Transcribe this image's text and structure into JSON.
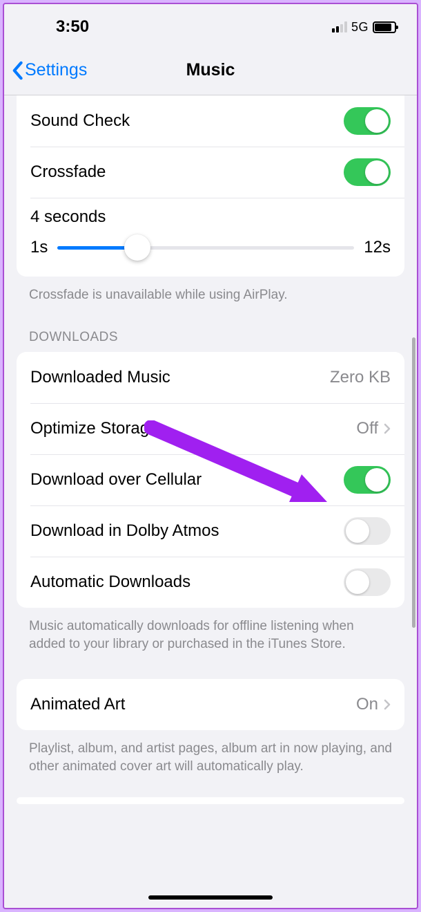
{
  "status": {
    "time": "3:50",
    "network": "5G",
    "signal_active_bars": 2,
    "battery_percent": 85
  },
  "nav": {
    "back_label": "Settings",
    "title": "Music"
  },
  "audio": {
    "sound_check": {
      "label": "Sound Check",
      "on": true
    },
    "crossfade": {
      "label": "Crossfade",
      "on": true
    },
    "slider": {
      "value_label": "4 seconds",
      "min_label": "1s",
      "max_label": "12s",
      "min": 1,
      "max": 12,
      "value": 4
    },
    "footer": "Crossfade is unavailable while using AirPlay."
  },
  "downloads": {
    "header": "DOWNLOADS",
    "downloaded_music": {
      "label": "Downloaded Music",
      "value": "Zero KB"
    },
    "optimize_storage": {
      "label": "Optimize Storage",
      "value": "Off"
    },
    "download_cellular": {
      "label": "Download over Cellular",
      "on": true
    },
    "download_dolby": {
      "label": "Download in Dolby Atmos",
      "on": false
    },
    "auto_downloads": {
      "label": "Automatic Downloads",
      "on": false
    },
    "footer": "Music automatically downloads for offline listening when added to your library or purchased in the iTunes Store."
  },
  "animated_art": {
    "label": "Animated Art",
    "value": "On",
    "footer": "Playlist, album, and artist pages, album art in now playing, and other animated cover art will automatically play."
  },
  "annotation": {
    "color": "#a020f0"
  }
}
